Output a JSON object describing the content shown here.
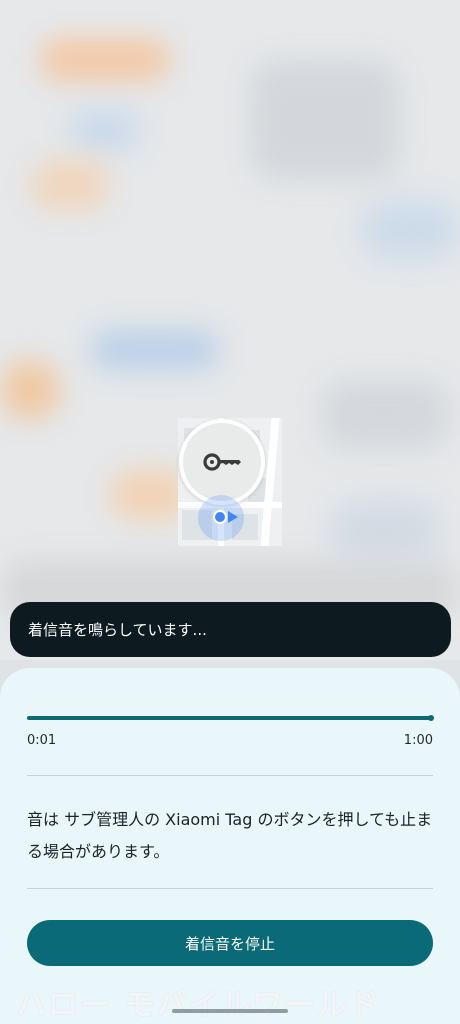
{
  "toast": {
    "text": "着信音を鳴らしています..."
  },
  "progress": {
    "fraction": 0.998,
    "start_time": "0:01",
    "end_time": "1:00"
  },
  "note": {
    "text": "音は サブ管理人の Xiaomi Tag のボタンを押しても止まる場合があります。"
  },
  "stop_button": {
    "label": "着信音を停止"
  },
  "watermark": {
    "text": "ハロー モバイルワールド"
  },
  "colors": {
    "accent": "#0b6a78",
    "sheet": "#e9f6fa",
    "toast": "#0d1a1f",
    "location": "#4285f4"
  },
  "icons": {
    "marker": "key-icon"
  }
}
